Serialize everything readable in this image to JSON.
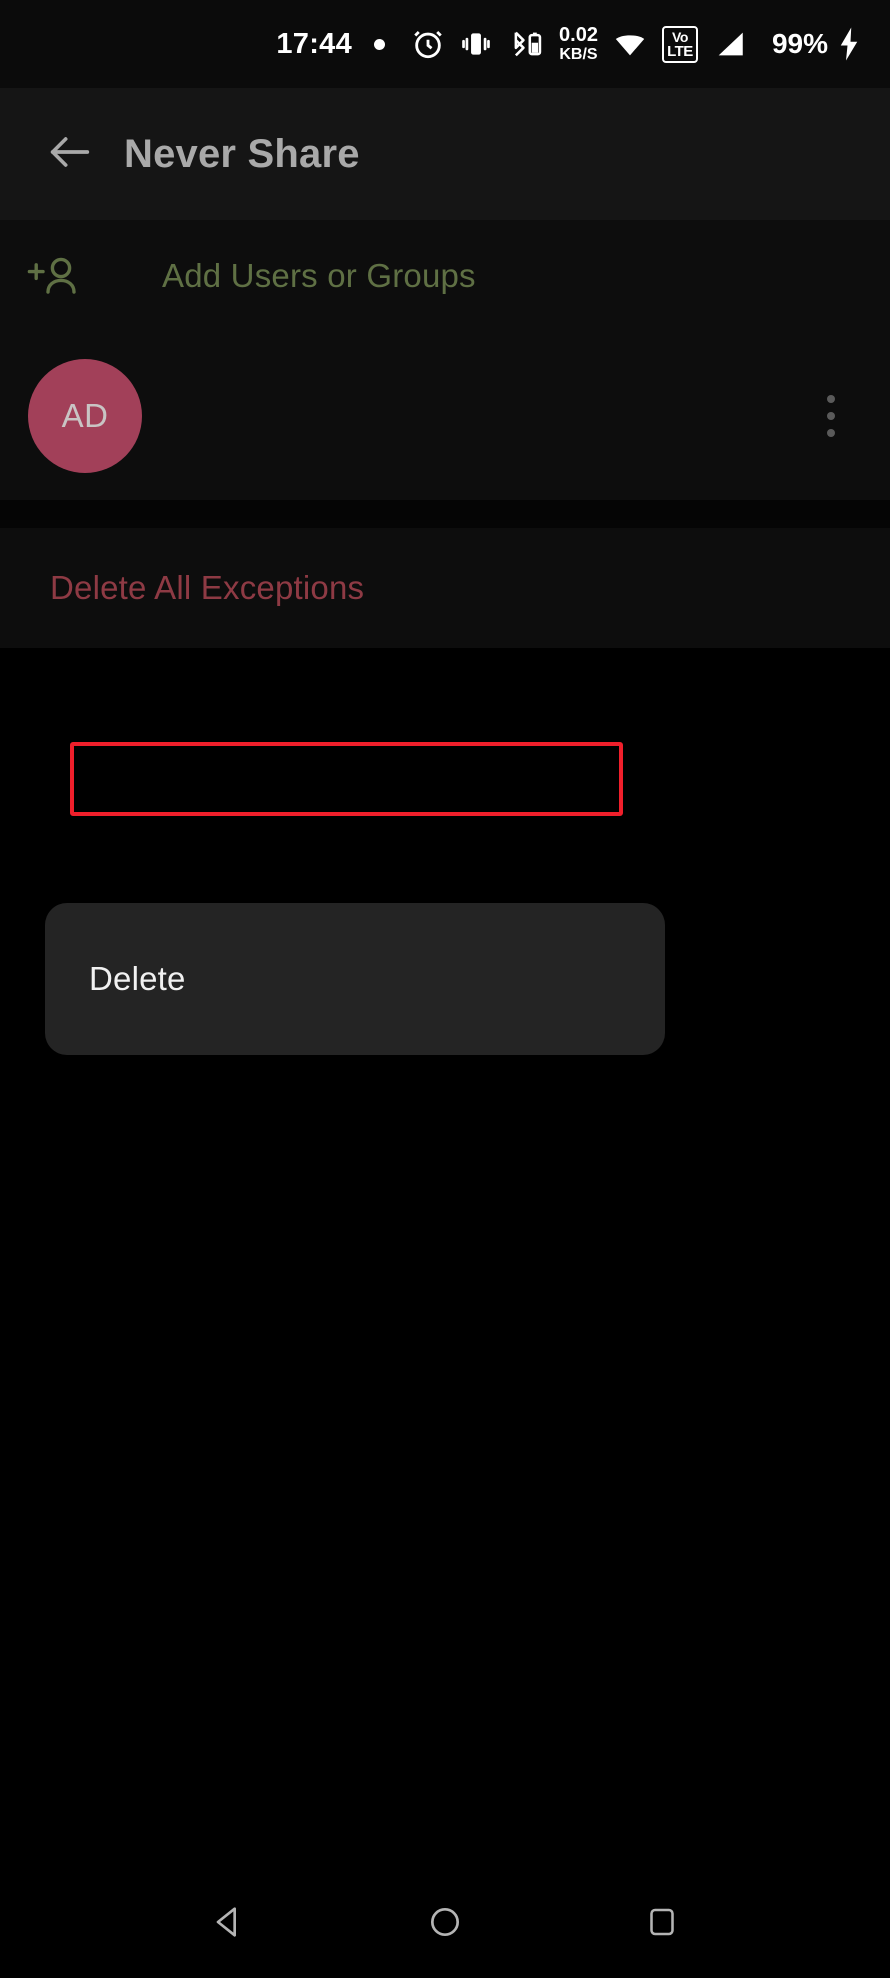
{
  "status_bar": {
    "time": "17:44",
    "dot_indicator": "•",
    "icons": [
      {
        "name": "alarm-icon",
        "label": "alarm"
      },
      {
        "name": "vibrate-icon",
        "label": "vibrate"
      },
      {
        "name": "bluetooth-battery-icon",
        "label": "bluetooth device battery"
      },
      {
        "name": "wifi-icon",
        "label": "wifi"
      },
      {
        "name": "volte-icon",
        "label": "VoLTE"
      },
      {
        "name": "signal-icon",
        "label": "cellular signal"
      },
      {
        "name": "charging-bolt-icon",
        "label": "charging"
      }
    ],
    "net_speed_value": "0.02",
    "net_speed_unit": "KB/S",
    "volte_line1": "Vo",
    "volte_line2": "LTE",
    "battery_percent": "99%"
  },
  "app_bar": {
    "back_label": "Back",
    "title": "Never Share"
  },
  "content": {
    "add_users_label": "Add Users or Groups",
    "add_users_icon": "person-add-icon",
    "user": {
      "initials": "AD",
      "avatar_color": "#a24059",
      "overflow_icon": "more-vertical-icon"
    },
    "delete_all_label": "Delete All Exceptions"
  },
  "popup_menu": {
    "items": [
      {
        "label": "Delete",
        "highlighted": true
      }
    ]
  },
  "annotation": {
    "color": "#f01f2b",
    "target": "Delete"
  },
  "nav_bar": {
    "back": "back-triangle-icon",
    "home": "home-circle-icon",
    "recents": "recents-square-icon"
  },
  "colors": {
    "background": "#000000",
    "surface": "#0d0d0d",
    "app_bar": "#151515",
    "accent_green": "#5f7044",
    "danger_red": "#8e3a44",
    "annotation_red": "#f01f2b",
    "popup_surface": "#242424",
    "title_text": "#a9a9a9"
  }
}
